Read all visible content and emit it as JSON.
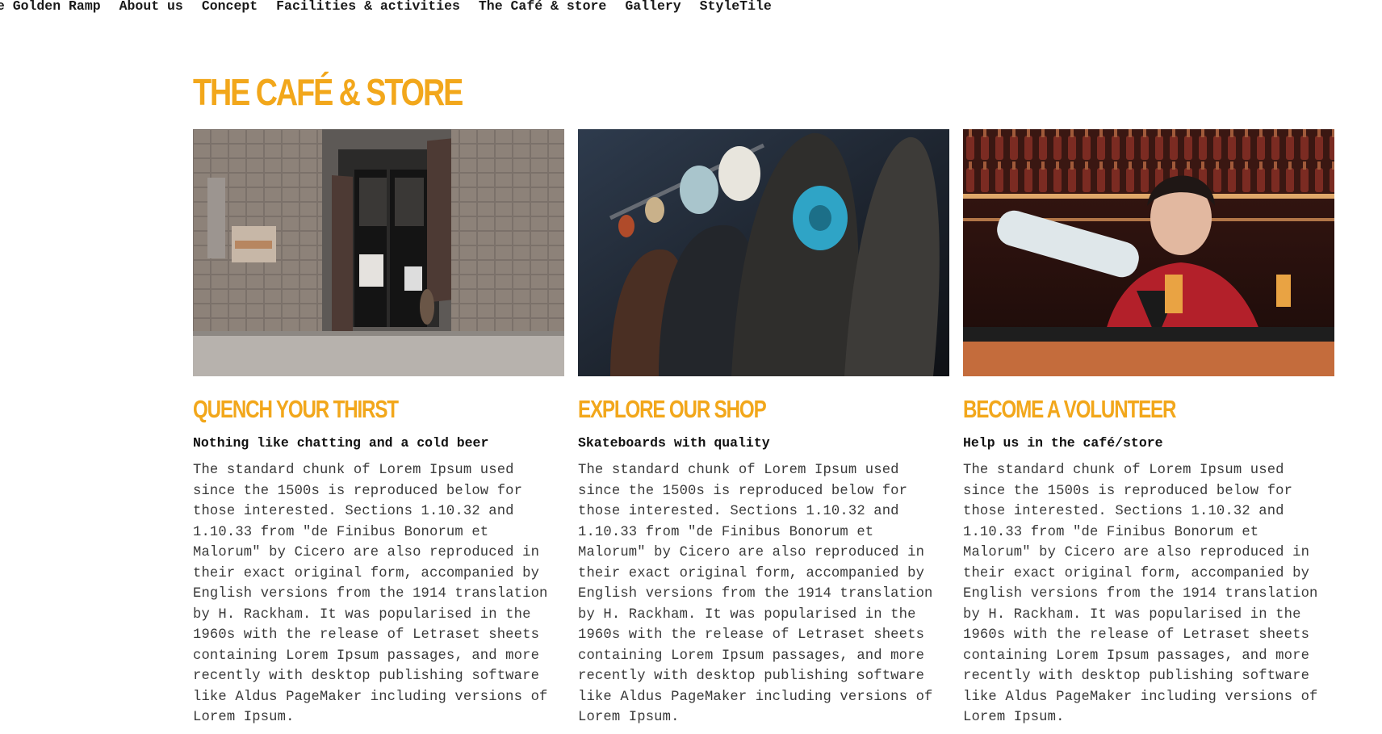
{
  "nav": {
    "items": [
      "he Golden Ramp",
      "About us",
      "Concept",
      "Facilities & activities",
      "The Café & store",
      "Gallery",
      "StyleTile"
    ]
  },
  "section": {
    "title": "THE CAFÉ & STORE"
  },
  "colors": {
    "accent": "#f2a71b",
    "text": "#3a3a3a"
  },
  "cards": [
    {
      "image": "store-entrance-photo",
      "heading": "QUENCH YOUR THIRST",
      "subheading": "Nothing like chatting and a cold beer",
      "body": "The standard chunk of Lorem Ipsum used since the 1500s is reproduced below for those interested. Sections 1.10.32 and 1.10.33 from \"de Finibus Bonorum et Malorum\" by Cicero are also reproduced in their exact original form, accompanied by English versions from the 1914 translation by H. Rackham. It was popularised in the 1960s with the release of Letraset sheets containing Lorem Ipsum passages, and more recently with desktop publishing software like Aldus PageMaker including versions of Lorem Ipsum."
    },
    {
      "image": "skateboards-photo",
      "heading": "EXPLORE OUR SHOP",
      "subheading": "Skateboards with quality",
      "body": "The standard chunk of Lorem Ipsum used since the 1500s is reproduced below for those interested. Sections 1.10.32 and 1.10.33 from \"de Finibus Bonorum et Malorum\" by Cicero are also reproduced in their exact original form, accompanied by English versions from the 1914 translation by H. Rackham. It was popularised in the 1960s with the release of Letraset sheets containing Lorem Ipsum passages, and more recently with desktop publishing software like Aldus PageMaker including versions of Lorem Ipsum."
    },
    {
      "image": "bartender-photo",
      "heading": "BECOME A VOLUNTEER",
      "subheading": "Help us in the café/store",
      "body": "The standard chunk of Lorem Ipsum used since the 1500s is reproduced below for those interested. Sections 1.10.32 and 1.10.33 from \"de Finibus Bonorum et Malorum\" by Cicero are also reproduced in their exact original form, accompanied by English versions from the 1914 translation by H. Rackham. It was popularised in the 1960s with the release of Letraset sheets containing Lorem Ipsum passages, and more recently with desktop publishing software like Aldus PageMaker including versions of Lorem Ipsum."
    }
  ]
}
